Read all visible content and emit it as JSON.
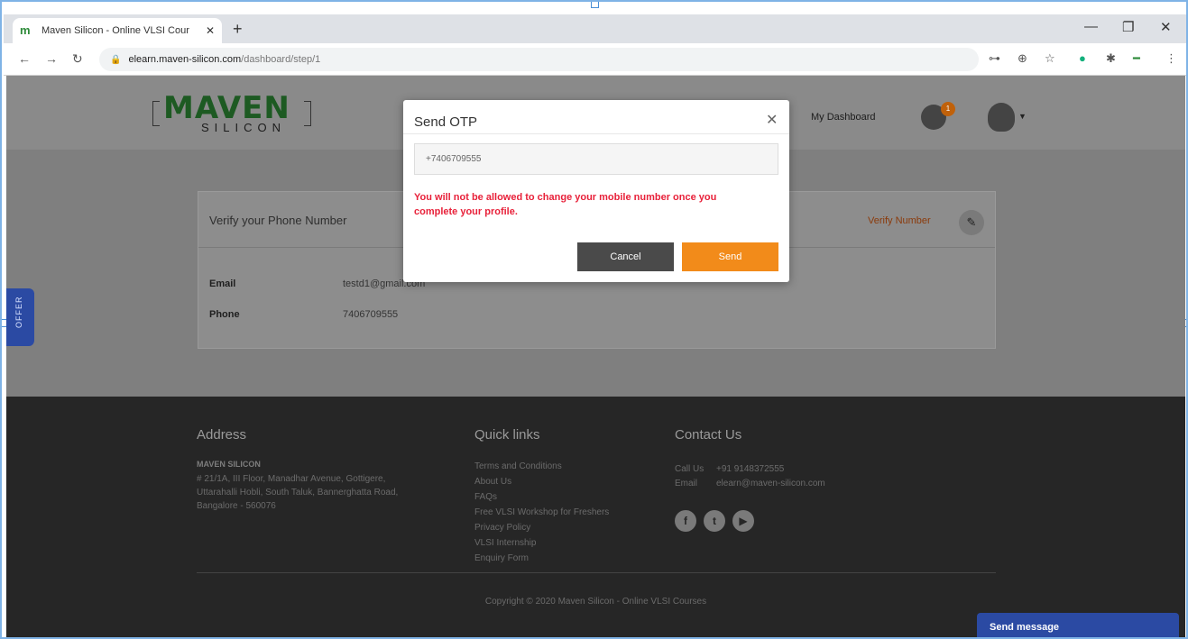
{
  "browser": {
    "tab_title": "Maven Silicon - Online VLSI Cour",
    "tab_close": "✕",
    "new_tab": "+",
    "favicon": "m",
    "url_host": "elearn.maven-silicon.com",
    "url_path": "/dashboard/step/1",
    "win_min": "—",
    "win_restore": "❐",
    "win_close": "✕",
    "ext_labels": [
      "⊶",
      "⊕",
      "☆",
      "●",
      "✱",
      "━",
      "⋮"
    ]
  },
  "header": {
    "logo_main": "MAVEN",
    "logo_sub": "SILICON",
    "dashboard_link": "My Dashboard",
    "badge_count": "1"
  },
  "card": {
    "title": "Verify your Phone Number",
    "verify_link": "Verify Number",
    "email_label": "Email",
    "email_value": "testd1@gmail.com",
    "phone_label": "Phone",
    "phone_value": "7406709555"
  },
  "offer_label": "OFFER",
  "footer": {
    "address_heading": "Address",
    "address_name": "MAVEN SILICON",
    "address_lines": "# 21/1A, III Floor, Manadhar Avenue, Gottigere, Uttarahalli Hobli, South Taluk, Bannerghatta Road, Bangalore - 560076",
    "quick_links_heading": "Quick links",
    "quick_links": [
      "Terms and Conditions",
      "About Us",
      "FAQs",
      "Free VLSI Workshop for Freshers",
      "Privacy Policy",
      "VLSI Internship",
      "Enquiry Form"
    ],
    "contact_heading": "Contact Us",
    "call_label": "Call Us",
    "call_value": "+91 9148372555",
    "email_label": "Email",
    "email_value": "elearn@maven-silicon.com",
    "social": [
      "f",
      "t",
      "▶"
    ],
    "copyright": "Copyright © 2020 Maven Silicon - Online VLSI Courses",
    "send_message": "Send message"
  },
  "modal": {
    "title": "Send OTP",
    "close": "✕",
    "phone_value": "+7406709555",
    "warning": "You will not be allowed to change your mobile number once you complete your profile.",
    "cancel_label": "Cancel",
    "send_label": "Send"
  },
  "colors": {
    "accent_orange": "#f28b1a",
    "warning_red": "#e8213a",
    "brand_green": "#1d5a22",
    "offer_blue": "#2b4aa3"
  }
}
